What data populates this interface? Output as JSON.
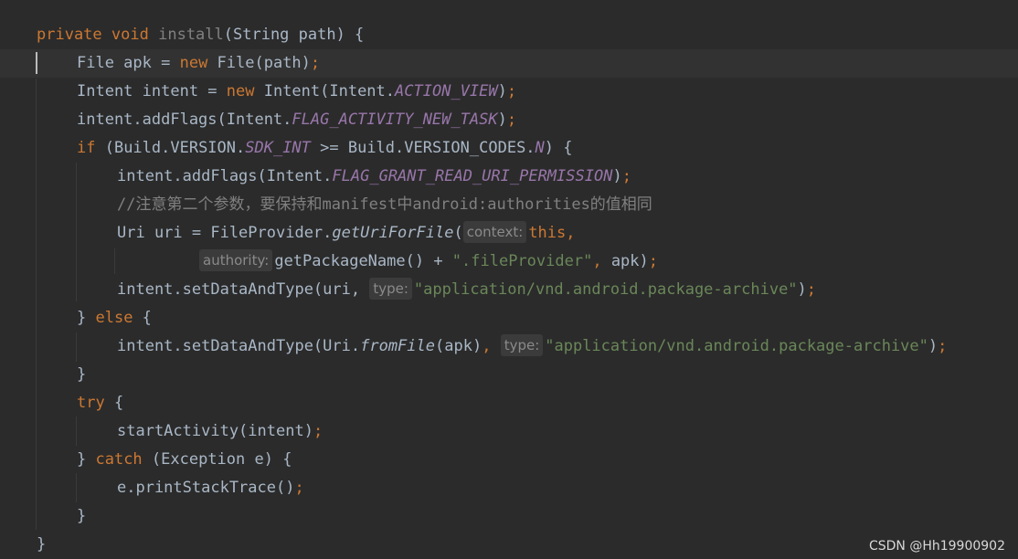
{
  "code": {
    "l1": {
      "kw_private": "private",
      "kw_void": "void",
      "method": "install",
      "rest": "(String path) {"
    },
    "l2": {
      "a": "File apk = ",
      "kw_new": "new",
      "b": " File(path)",
      "semi": ";"
    },
    "l3": {
      "a": "Intent intent = ",
      "kw_new": "new",
      "b": " Intent(Intent.",
      "const": "ACTION_VIEW",
      "c": ")",
      "semi": ";"
    },
    "l4": {
      "a": "intent.addFlags(Intent.",
      "const": "FLAG_ACTIVITY_NEW_TASK",
      "b": ")",
      "semi": ";"
    },
    "l5": {
      "kw_if": "if",
      "a": " (Build.VERSION.",
      "const": "SDK_INT",
      "b": " >= Build.VERSION_CODES.",
      "const2": "N",
      "c": ") {"
    },
    "l6": {
      "a": "intent.addFlags(Intent.",
      "const": "FLAG_GRANT_READ_URI_PERMISSION",
      "b": ")",
      "semi": ";"
    },
    "l7": {
      "comment": "//注意第二个参数，要保持和manifest中android:authorities的值相同"
    },
    "l8": {
      "a": "Uri uri = FileProvider.",
      "method": "getUriForFile",
      "b": "(",
      "hint": "context:",
      "kw_this": "this",
      "comma": ","
    },
    "l9": {
      "hint": "authority:",
      "a": "getPackageName() + ",
      "str": "\".fileProvider\"",
      "comma": ",",
      "b": " apk)",
      "semi": ";"
    },
    "l10": {
      "a": "intent.setDataAndType(uri, ",
      "hint": "type:",
      "str": "\"application/vnd.android.package-archive\"",
      "b": ")",
      "semi": ";"
    },
    "l11": {
      "a": "} ",
      "kw_else": "else",
      "b": " {"
    },
    "l12": {
      "a": "intent.setDataAndType(Uri.",
      "method": "fromFile",
      "b": "(apk)",
      "comma": ",",
      "hint": "type:",
      "str": "\"application/vnd.android.package-archive\"",
      "c": ")",
      "semi": ";"
    },
    "l13": {
      "a": "}"
    },
    "l14": {
      "kw_try": "try",
      "a": " {"
    },
    "l15": {
      "a": "startActivity(intent)",
      "semi": ";"
    },
    "l16": {
      "a": "} ",
      "kw_catch": "catch",
      "b": " (Exception e) {"
    },
    "l17": {
      "a": "e.printStackTrace()",
      "semi": ";"
    },
    "l18": {
      "a": "}"
    },
    "l19": {
      "a": "}"
    }
  },
  "watermark": "CSDN @Hh19900902",
  "colors": {
    "background": "#2b2b2b",
    "keyword": "#cc7832",
    "text": "#a9b7c6",
    "static_field": "#9876aa",
    "string": "#6a8759",
    "comment": "#808080"
  }
}
